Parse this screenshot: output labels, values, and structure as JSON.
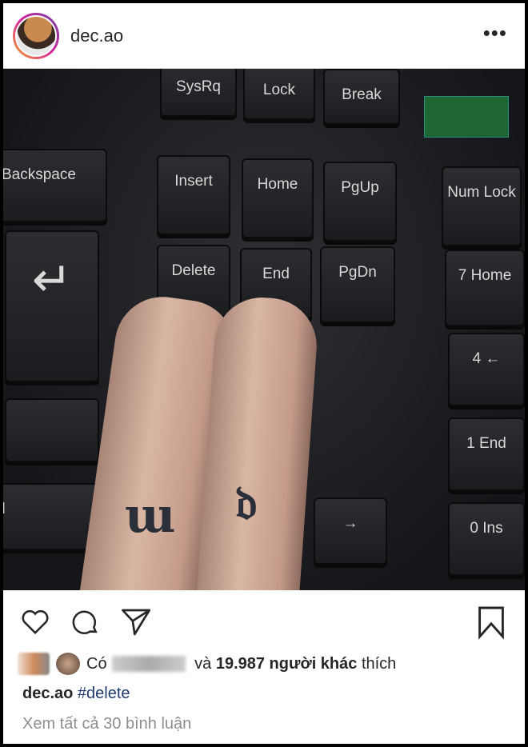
{
  "post": {
    "username": "dec.ao",
    "more_icon": "•••",
    "photo_keys": [
      "SysRq",
      "Lock",
      "Break",
      "Backspace",
      "Insert",
      "Home",
      "PgUp",
      "Num Lock",
      "Delete",
      "End",
      "PgDn",
      "7 Home",
      "4 ←",
      "1 End",
      "0 Ins",
      "→",
      "↵",
      "rl"
    ],
    "likes": {
      "prefix": "Có",
      "middle": " và ",
      "count_text": "19.987 người khác",
      "suffix": " thích"
    },
    "caption": {
      "username": "dec.ao",
      "hashtag": "#delete"
    },
    "view_comments": "Xem tất cả 30 bình luận",
    "colors": {
      "hashtag": "#1d3a6b",
      "text": "#262626",
      "muted": "#8e8e8e"
    }
  }
}
